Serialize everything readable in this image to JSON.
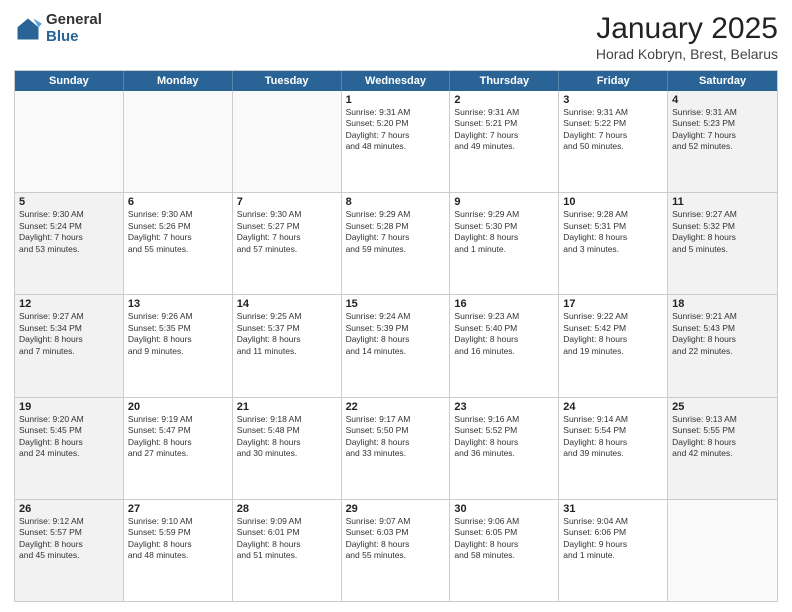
{
  "header": {
    "logo_general": "General",
    "logo_blue": "Blue",
    "month_title": "January 2025",
    "location": "Horad Kobryn, Brest, Belarus"
  },
  "weekdays": [
    "Sunday",
    "Monday",
    "Tuesday",
    "Wednesday",
    "Thursday",
    "Friday",
    "Saturday"
  ],
  "weeks": [
    [
      {
        "day": "",
        "text": "",
        "shaded": false,
        "empty": true
      },
      {
        "day": "",
        "text": "",
        "shaded": false,
        "empty": true
      },
      {
        "day": "",
        "text": "",
        "shaded": false,
        "empty": true
      },
      {
        "day": "1",
        "text": "Sunrise: 9:31 AM\nSunset: 5:20 PM\nDaylight: 7 hours\nand 48 minutes.",
        "shaded": false,
        "empty": false
      },
      {
        "day": "2",
        "text": "Sunrise: 9:31 AM\nSunset: 5:21 PM\nDaylight: 7 hours\nand 49 minutes.",
        "shaded": false,
        "empty": false
      },
      {
        "day": "3",
        "text": "Sunrise: 9:31 AM\nSunset: 5:22 PM\nDaylight: 7 hours\nand 50 minutes.",
        "shaded": false,
        "empty": false
      },
      {
        "day": "4",
        "text": "Sunrise: 9:31 AM\nSunset: 5:23 PM\nDaylight: 7 hours\nand 52 minutes.",
        "shaded": true,
        "empty": false
      }
    ],
    [
      {
        "day": "5",
        "text": "Sunrise: 9:30 AM\nSunset: 5:24 PM\nDaylight: 7 hours\nand 53 minutes.",
        "shaded": true,
        "empty": false
      },
      {
        "day": "6",
        "text": "Sunrise: 9:30 AM\nSunset: 5:26 PM\nDaylight: 7 hours\nand 55 minutes.",
        "shaded": false,
        "empty": false
      },
      {
        "day": "7",
        "text": "Sunrise: 9:30 AM\nSunset: 5:27 PM\nDaylight: 7 hours\nand 57 minutes.",
        "shaded": false,
        "empty": false
      },
      {
        "day": "8",
        "text": "Sunrise: 9:29 AM\nSunset: 5:28 PM\nDaylight: 7 hours\nand 59 minutes.",
        "shaded": false,
        "empty": false
      },
      {
        "day": "9",
        "text": "Sunrise: 9:29 AM\nSunset: 5:30 PM\nDaylight: 8 hours\nand 1 minute.",
        "shaded": false,
        "empty": false
      },
      {
        "day": "10",
        "text": "Sunrise: 9:28 AM\nSunset: 5:31 PM\nDaylight: 8 hours\nand 3 minutes.",
        "shaded": false,
        "empty": false
      },
      {
        "day": "11",
        "text": "Sunrise: 9:27 AM\nSunset: 5:32 PM\nDaylight: 8 hours\nand 5 minutes.",
        "shaded": true,
        "empty": false
      }
    ],
    [
      {
        "day": "12",
        "text": "Sunrise: 9:27 AM\nSunset: 5:34 PM\nDaylight: 8 hours\nand 7 minutes.",
        "shaded": true,
        "empty": false
      },
      {
        "day": "13",
        "text": "Sunrise: 9:26 AM\nSunset: 5:35 PM\nDaylight: 8 hours\nand 9 minutes.",
        "shaded": false,
        "empty": false
      },
      {
        "day": "14",
        "text": "Sunrise: 9:25 AM\nSunset: 5:37 PM\nDaylight: 8 hours\nand 11 minutes.",
        "shaded": false,
        "empty": false
      },
      {
        "day": "15",
        "text": "Sunrise: 9:24 AM\nSunset: 5:39 PM\nDaylight: 8 hours\nand 14 minutes.",
        "shaded": false,
        "empty": false
      },
      {
        "day": "16",
        "text": "Sunrise: 9:23 AM\nSunset: 5:40 PM\nDaylight: 8 hours\nand 16 minutes.",
        "shaded": false,
        "empty": false
      },
      {
        "day": "17",
        "text": "Sunrise: 9:22 AM\nSunset: 5:42 PM\nDaylight: 8 hours\nand 19 minutes.",
        "shaded": false,
        "empty": false
      },
      {
        "day": "18",
        "text": "Sunrise: 9:21 AM\nSunset: 5:43 PM\nDaylight: 8 hours\nand 22 minutes.",
        "shaded": true,
        "empty": false
      }
    ],
    [
      {
        "day": "19",
        "text": "Sunrise: 9:20 AM\nSunset: 5:45 PM\nDaylight: 8 hours\nand 24 minutes.",
        "shaded": true,
        "empty": false
      },
      {
        "day": "20",
        "text": "Sunrise: 9:19 AM\nSunset: 5:47 PM\nDaylight: 8 hours\nand 27 minutes.",
        "shaded": false,
        "empty": false
      },
      {
        "day": "21",
        "text": "Sunrise: 9:18 AM\nSunset: 5:48 PM\nDaylight: 8 hours\nand 30 minutes.",
        "shaded": false,
        "empty": false
      },
      {
        "day": "22",
        "text": "Sunrise: 9:17 AM\nSunset: 5:50 PM\nDaylight: 8 hours\nand 33 minutes.",
        "shaded": false,
        "empty": false
      },
      {
        "day": "23",
        "text": "Sunrise: 9:16 AM\nSunset: 5:52 PM\nDaylight: 8 hours\nand 36 minutes.",
        "shaded": false,
        "empty": false
      },
      {
        "day": "24",
        "text": "Sunrise: 9:14 AM\nSunset: 5:54 PM\nDaylight: 8 hours\nand 39 minutes.",
        "shaded": false,
        "empty": false
      },
      {
        "day": "25",
        "text": "Sunrise: 9:13 AM\nSunset: 5:55 PM\nDaylight: 8 hours\nand 42 minutes.",
        "shaded": true,
        "empty": false
      }
    ],
    [
      {
        "day": "26",
        "text": "Sunrise: 9:12 AM\nSunset: 5:57 PM\nDaylight: 8 hours\nand 45 minutes.",
        "shaded": true,
        "empty": false
      },
      {
        "day": "27",
        "text": "Sunrise: 9:10 AM\nSunset: 5:59 PM\nDaylight: 8 hours\nand 48 minutes.",
        "shaded": false,
        "empty": false
      },
      {
        "day": "28",
        "text": "Sunrise: 9:09 AM\nSunset: 6:01 PM\nDaylight: 8 hours\nand 51 minutes.",
        "shaded": false,
        "empty": false
      },
      {
        "day": "29",
        "text": "Sunrise: 9:07 AM\nSunset: 6:03 PM\nDaylight: 8 hours\nand 55 minutes.",
        "shaded": false,
        "empty": false
      },
      {
        "day": "30",
        "text": "Sunrise: 9:06 AM\nSunset: 6:05 PM\nDaylight: 8 hours\nand 58 minutes.",
        "shaded": false,
        "empty": false
      },
      {
        "day": "31",
        "text": "Sunrise: 9:04 AM\nSunset: 6:06 PM\nDaylight: 9 hours\nand 1 minute.",
        "shaded": false,
        "empty": false
      },
      {
        "day": "",
        "text": "",
        "shaded": true,
        "empty": true
      }
    ]
  ]
}
